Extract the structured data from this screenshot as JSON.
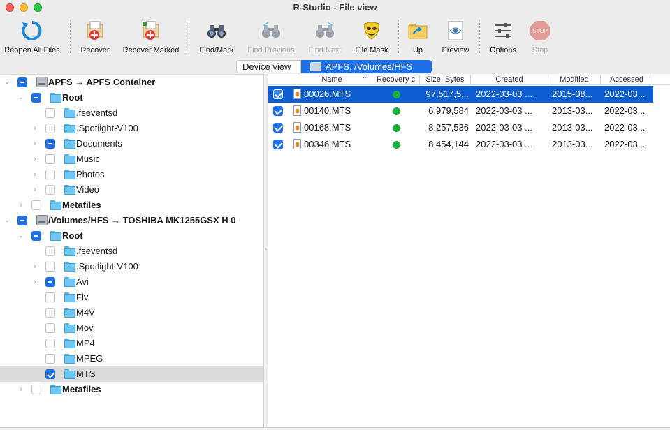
{
  "window": {
    "title": "R-Studio - File view"
  },
  "toolbar": {
    "reopen": "Reopen All Files",
    "recover": "Recover",
    "recover_marked": "Recover Marked",
    "find_mark": "Find/Mark",
    "find_previous": "Find Previous",
    "find_next": "Find Next",
    "file_mask": "File Mask",
    "up": "Up",
    "preview": "Preview",
    "options": "Options",
    "stop": "Stop"
  },
  "tabs": {
    "device_view": "Device view",
    "apfs": "APFS, /Volumes/HFS"
  },
  "tree": [
    {
      "label": "APFS → APFS Container",
      "bold": true
    },
    {
      "label": "Root",
      "bold": true
    },
    {
      "label": ".fseventsd"
    },
    {
      "label": ".Spotlight-V100"
    },
    {
      "label": "Documents"
    },
    {
      "label": "Music"
    },
    {
      "label": "Photos"
    },
    {
      "label": "Video"
    },
    {
      "label": "Metafiles",
      "bold": true
    },
    {
      "label": "/Volumes/HFS → TOSHIBA MK1255GSX H 0",
      "bold": true
    },
    {
      "label": "Root",
      "bold": true
    },
    {
      "label": ".fseventsd"
    },
    {
      "label": ".Spotlight-V100"
    },
    {
      "label": "Avi"
    },
    {
      "label": "Flv"
    },
    {
      "label": "M4V"
    },
    {
      "label": "Mov"
    },
    {
      "label": "MP4"
    },
    {
      "label": "MPEG"
    },
    {
      "label": "MTS"
    },
    {
      "label": "Metafiles",
      "bold": true
    }
  ],
  "list": {
    "columns": {
      "name": "Name",
      "recovery": "Recovery c",
      "size": "Size, Bytes",
      "created": "Created",
      "modified": "Modified",
      "accessed": "Accessed"
    },
    "rows": [
      {
        "name": "00026.MTS",
        "size": "97,517,5...",
        "created": "2022-03-03 ...",
        "modified": "2015-08...",
        "accessed": "2022-03..."
      },
      {
        "name": "00140.MTS",
        "size": "6,979,584",
        "created": "2022-03-03 ...",
        "modified": "2013-03...",
        "accessed": "2022-03..."
      },
      {
        "name": "00168.MTS",
        "size": "8,257,536",
        "created": "2022-03-03 ...",
        "modified": "2013-03...",
        "accessed": "2022-03..."
      },
      {
        "name": "00346.MTS",
        "size": "8,454,144",
        "created": "2022-03-03 ...",
        "modified": "2013-03...",
        "accessed": "2022-03..."
      }
    ]
  }
}
